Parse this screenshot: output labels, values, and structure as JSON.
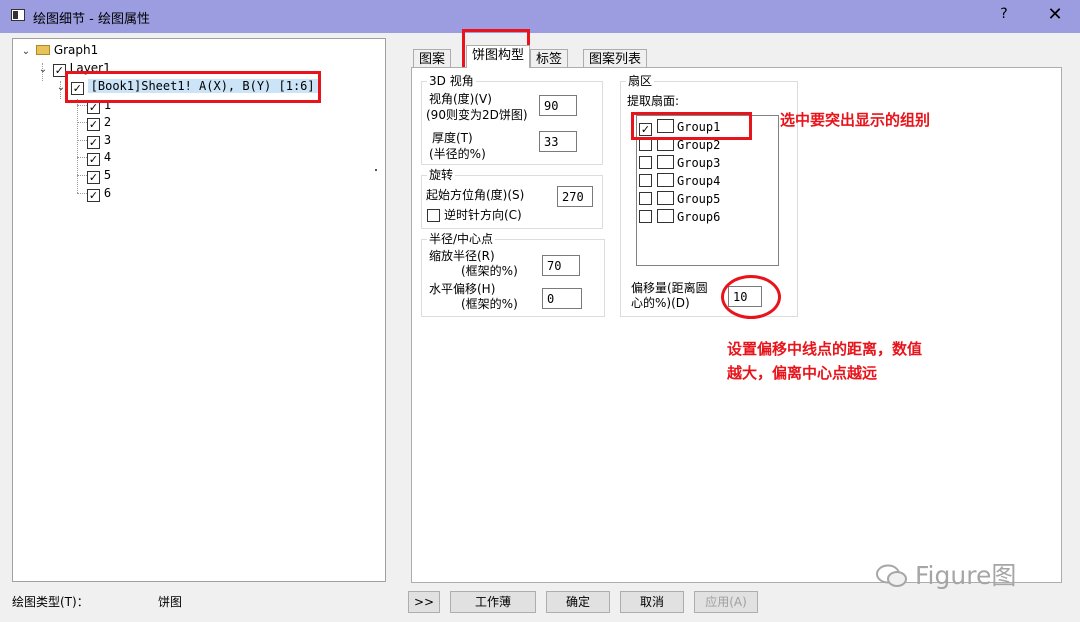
{
  "window": {
    "title": "绘图细节 - 绘图属性",
    "help_label": "?",
    "close_label": "✕"
  },
  "tree": {
    "root": "Graph1",
    "layer": "Layer1",
    "data_item": "[Book1]Sheet1! A(X), B(Y) [1:6]",
    "children": [
      "1",
      "2",
      "3",
      "4",
      "5",
      "6"
    ]
  },
  "plot_type": {
    "label": "绘图类型(T)：",
    "value": "饼图"
  },
  "tabs": [
    "图案",
    "饼图构型",
    "标签",
    "图案列表"
  ],
  "view_3d": {
    "title": "3D 视角",
    "view_angle_label": "视角(度)(V)",
    "view_angle_note": "(90则变为2D饼图)",
    "view_angle_value": "90",
    "thickness_label": "厚度(T)",
    "thickness_note": "(半径的%)",
    "thickness_value": "33"
  },
  "rotation": {
    "title": "旋转",
    "start_azimuth_label": "起始方位角(度)(S)",
    "start_azimuth_value": "270",
    "counterclockwise_label": "逆时针方向(C)",
    "counterclockwise_checked": false
  },
  "radius_center": {
    "title": "半径/中心点",
    "scale_radius_label": "缩放半径(R)",
    "scale_radius_note": "(框架的%)",
    "scale_radius_value": "70",
    "h_offset_label": "水平偏移(H)",
    "h_offset_note": "(框架的%)",
    "h_offset_value": "0"
  },
  "sector": {
    "title": "扇区",
    "extract_label": "提取扇面:",
    "groups": [
      {
        "name": "Group1",
        "checked": true
      },
      {
        "name": "Group2",
        "checked": false
      },
      {
        "name": "Group3",
        "checked": false
      },
      {
        "name": "Group4",
        "checked": false
      },
      {
        "name": "Group5",
        "checked": false
      },
      {
        "name": "Group6",
        "checked": false
      }
    ],
    "offset_label_line1": "偏移量(距离圆",
    "offset_label_line2": "心的%)(D)",
    "offset_value": "10"
  },
  "annotations": {
    "select_group": "选中要突出显示的组别",
    "offset_line1": "设置偏移中线点的距离，数值",
    "offset_line2": "越大，偏离中心点越远"
  },
  "watermark": "Figure图",
  "buttons": {
    "expand": ">>",
    "workbook": "工作薄",
    "ok": "确定",
    "cancel": "取消",
    "apply": "应用(A)"
  },
  "colors": {
    "titlebar": "#9b9de0",
    "annotation_red": "#e8141b"
  }
}
